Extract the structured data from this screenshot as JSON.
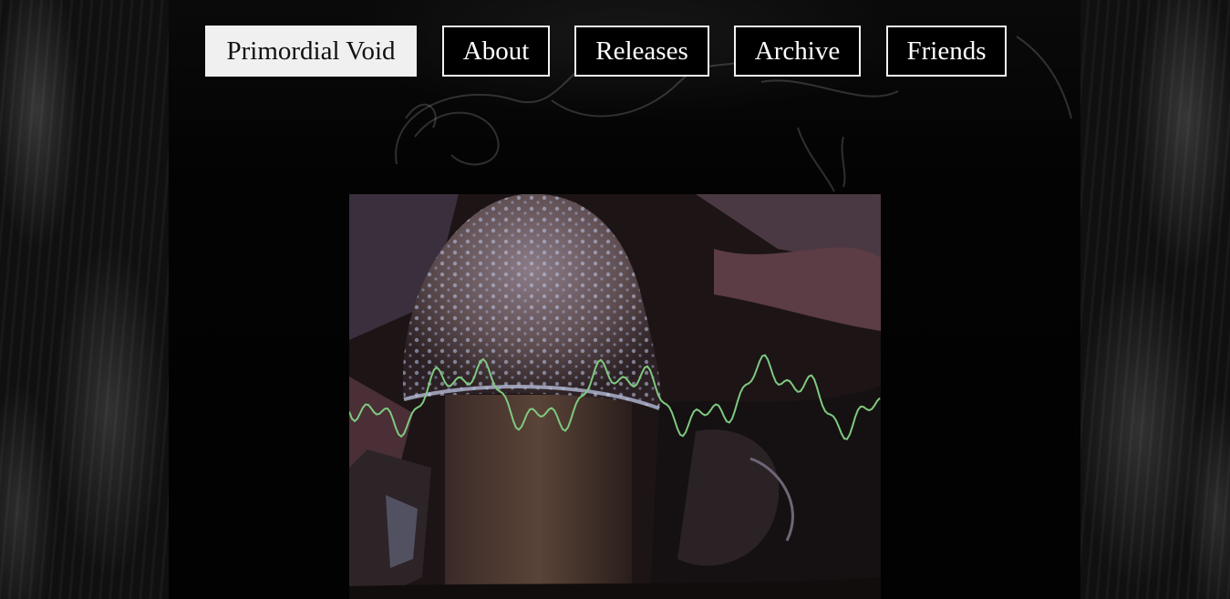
{
  "nav": {
    "brand_label": "Primordial Void",
    "about_label": "About",
    "releases_label": "Releases",
    "archive_label": "Archive",
    "friends_label": "Friends"
  },
  "video": {
    "waveform_color": "#7fc97f"
  },
  "colors": {
    "background": "#000000",
    "nav_border": "#f2f2f2",
    "brand_fill": "#f0f0f0"
  }
}
